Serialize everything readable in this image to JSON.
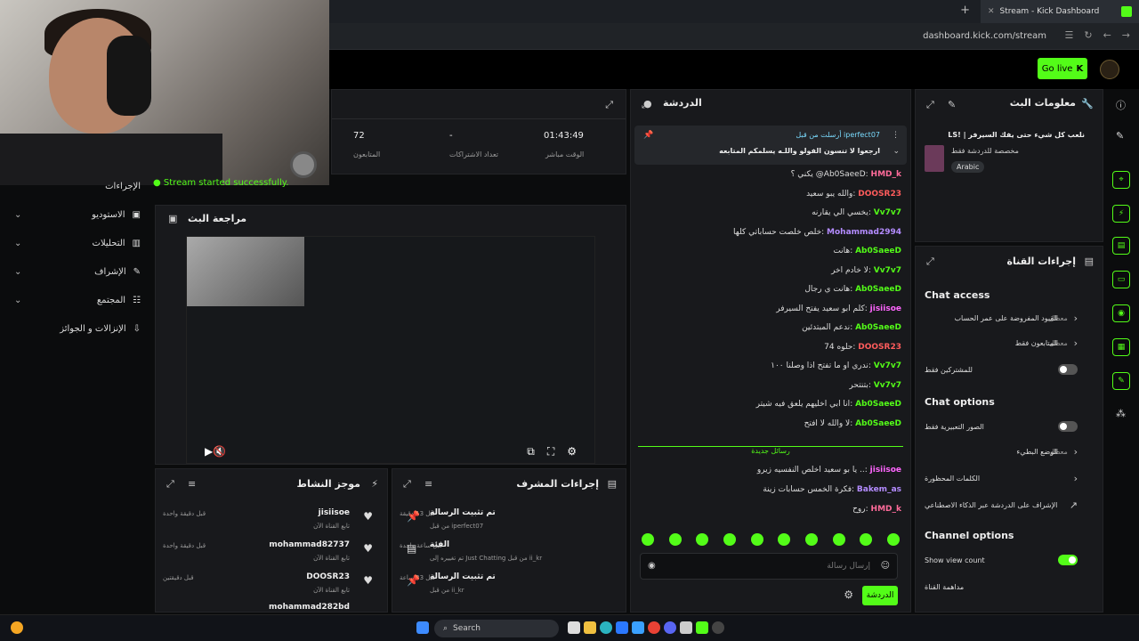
{
  "browser": {
    "tab_title": "Stream - Kick Dashboard",
    "url": "dashboard.kick.com/stream"
  },
  "header": {
    "go_live": "Go live"
  },
  "sidebar": {
    "items": [
      {
        "label": "الإجراءات"
      },
      {
        "label": "الاستوديو"
      },
      {
        "label": "التحليلات"
      },
      {
        "label": "الإشراف"
      },
      {
        "label": "المجتمع"
      },
      {
        "label": "الإنزالات و الجوائز"
      }
    ]
  },
  "stats": {
    "items": [
      {
        "value": "01:43:49",
        "label": "الوقت مباشر"
      },
      {
        "value": "-",
        "label": "تعداد الاشتراكات"
      },
      {
        "value": "72",
        "label": "المتابعون"
      }
    ]
  },
  "toast": "Stream started successfully.",
  "preview": {
    "title": "مراجعة البث"
  },
  "activity": {
    "title": "موجز النشاط",
    "rows": [
      {
        "name": "jisiisoe",
        "sub": "تابع القناة الآن",
        "time": "قبل دقيقة واحدة"
      },
      {
        "name": "mohammad82737",
        "sub": "تابع القناة الآن",
        "time": "قبل دقيقة واحدة"
      },
      {
        "name": "DOOSR23",
        "sub": "تابع القناة الآن",
        "time": "قبل دقيقتين"
      },
      {
        "name": "mohammad282bd",
        "sub": "",
        "time": ""
      }
    ]
  },
  "mod": {
    "title": "إجراءات المشرف",
    "rows": [
      {
        "name": "تم تثبيت الرسالة",
        "sub": "من قبل iperfect07",
        "time": "قبل 13 دقيقة"
      },
      {
        "name": "الفئة",
        "sub": "تم تغييره إلى Just Chatting من قبل ii_kr",
        "time": "قبل ساعة واحدة"
      },
      {
        "name": "تم تثبيت الرسالة",
        "sub": "من قبل ii_kr",
        "time": "قبل 23 ساعة"
      }
    ]
  },
  "chat": {
    "title": "الدردشة",
    "pinned": {
      "by": "أرسلت من قبل iperfect07",
      "text": "ارجعوا لا تنسون الفولو واللـه يسلمكم المتابعه"
    },
    "messages": [
      {
        "user": "HMD_k",
        "text": "يكني ؟ @Ab0SaeeD",
        "color": "#ff6b9a"
      },
      {
        "user": "DOOSR23",
        "text": "والله يبو سعيد",
        "color": "#ff5c5c"
      },
      {
        "user": "Vv7v7",
        "text": "يخسي الي يقارنه",
        "color": "#53fc18"
      },
      {
        "user": "Mohammad2994",
        "text": "خلص خلصت حساباتي كلها",
        "color": "#b48cff"
      },
      {
        "user": "Ab0SaeeD",
        "text": "هانت",
        "color": "#53fc18"
      },
      {
        "user": "Vv7v7",
        "text": "لا خادم اخر",
        "color": "#53fc18"
      },
      {
        "user": "Ab0SaeeD",
        "text": "هانت ي رجال",
        "color": "#53fc18"
      },
      {
        "user": "jisiisoe",
        "text": "كلم ابو سعيد يفتح السيرفر",
        "color": "#ff66ff"
      },
      {
        "user": "Ab0SaeeD",
        "text": "ندعم المبتدئين",
        "color": "#53fc18"
      },
      {
        "user": "DOOSR23",
        "text": "حلوه 74",
        "color": "#ff5c5c"
      },
      {
        "user": "Vv7v7",
        "text": "ندري او ما تفتح اذا وصلنا ١٠٠",
        "color": "#53fc18"
      },
      {
        "user": "Vv7v7",
        "text": "بتنتحر",
        "color": "#53fc18"
      },
      {
        "user": "Ab0SaeeD",
        "text": "انا ابي اخليهم يلعق فيه شيتر",
        "color": "#53fc18"
      },
      {
        "user": "Ab0SaeeD",
        "text": "لا والله لا افتح",
        "color": "#53fc18"
      }
    ],
    "new_label": "رسائل جديدة",
    "new_messages": [
      {
        "user": "jisiisoe",
        "text": "يا بو سعيد اخلص النفسيه زيرو ..",
        "color": "#ff66ff"
      },
      {
        "user": "Bakem_as",
        "text": "فكرة الخمس حسابات زينة",
        "color": "#b48cff"
      },
      {
        "user": "HMD_k",
        "text": "روح",
        "color": "#ff6b9a"
      }
    ],
    "input_placeholder": "إرسال رسالة",
    "send_label": "الدردشة"
  },
  "streaminfo": {
    "title": "معلومات البث",
    "stream_title": "LS! | نلعب كل شيء حتى يفك السيرفر",
    "category": "مخصصة للدردشة فقط",
    "language": "Arabic"
  },
  "chanactions": {
    "title": "إجراءات القناة",
    "chat_access": "Chat access",
    "chat_options": "Chat options",
    "channel_options": "Channel options",
    "rows_access": [
      {
        "label": "القيود المفروضة على عمر الحساب",
        "state": "معطل"
      },
      {
        "label": "المتابعون فقط",
        "state": "معطل"
      },
      {
        "label": "للمشتركين فقط",
        "state": ""
      }
    ],
    "rows_options": [
      {
        "label": "الصور التعبيرية فقط",
        "state": ""
      },
      {
        "label": "الوضع البطيء",
        "state": "معطل"
      },
      {
        "label": "الكلمات المحظورة",
        "state": ""
      },
      {
        "label": "الإشراف على الدردشة عبر الذكاء الاصطناعي",
        "state": ""
      }
    ],
    "show_view_count": "Show view count",
    "raid_label": "مداهمة القناة"
  },
  "taskbar": {
    "search": "Search"
  },
  "colors": {
    "accent": "#53fc18",
    "panel": "#18191c",
    "bg": "#0b0c0d"
  }
}
